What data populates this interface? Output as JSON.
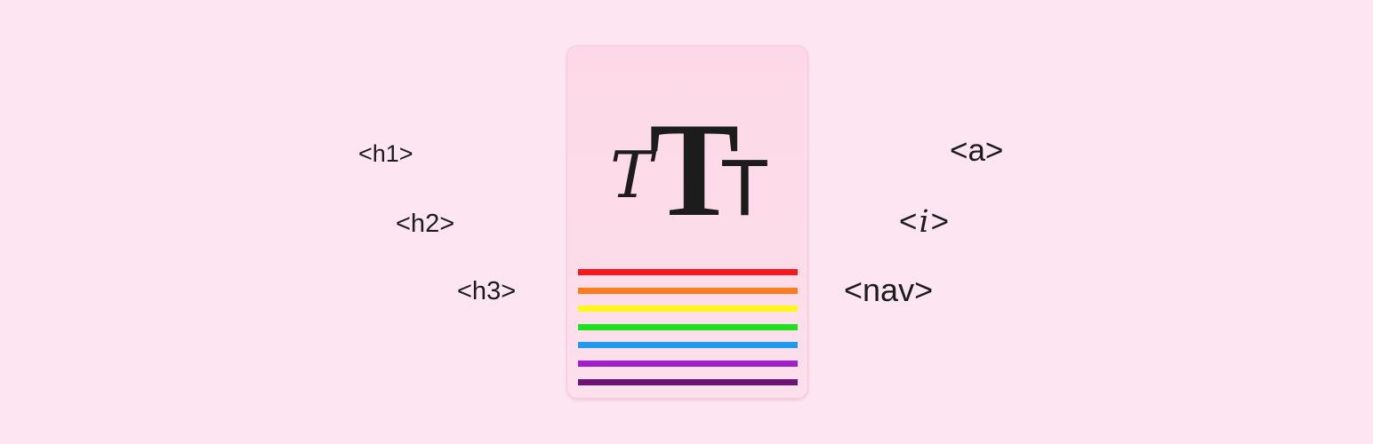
{
  "tags_left": {
    "h1": "<h1>",
    "h2": "<h2>",
    "h3": "<h3>"
  },
  "tags_right": {
    "a": "<a>",
    "i_open": "<",
    "i_letter": "i",
    "i_close": ">",
    "nav": "<nav>"
  },
  "card": {
    "icon": "typography-icon",
    "glyph_script": "T",
    "glyph_large": "T",
    "glyph_small": "T",
    "stripe_colors": [
      "#f5181e",
      "#fd7c1f",
      "#fdf71a",
      "#1be21b",
      "#1d9bf1",
      "#a11ecb",
      "#6c1577"
    ]
  },
  "colors": {
    "background": "#fde6f2",
    "card": "#fdd9e8",
    "text": "#1c1c1c"
  }
}
